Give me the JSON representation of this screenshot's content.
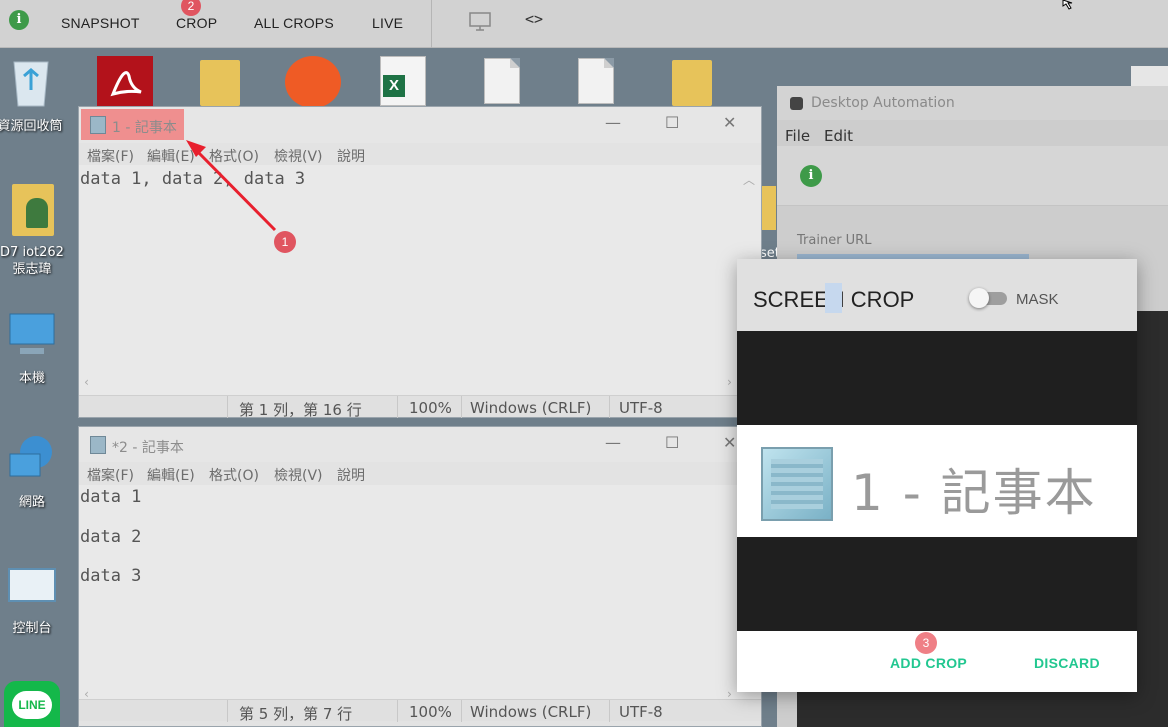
{
  "toolbar": {
    "info": "i",
    "items": [
      "SNAPSHOT",
      "CROP",
      "ALL CROPS",
      "LIVE"
    ],
    "crop_badge": "2",
    "code_icon": "<>"
  },
  "desktop": {
    "recycle_bin": "資源回收筒",
    "user_folder_line1": "D7 iot262",
    "user_folder_line2": "張志瑋",
    "this_pc": "本機",
    "network": "網路",
    "control_panel": "控制台",
    "line_app": "LINE",
    "partial_label": "set"
  },
  "notepad1": {
    "title": "1 - 記事本",
    "menu": [
      "檔案(F)",
      "編輯(E)",
      "格式(O)",
      "檢視(V)",
      "說明"
    ],
    "content": "data 1, data 2, data 3",
    "status": [
      "第 1 列，第 16 行",
      "100%",
      "Windows (CRLF)",
      "UTF-8"
    ]
  },
  "notepad2": {
    "title": "*2 - 記事本",
    "menu": [
      "檔案(F)",
      "編輯(E)",
      "格式(O)",
      "檢視(V)",
      "說明"
    ],
    "lines": [
      "data 1",
      "data 2",
      "data 3"
    ],
    "status": [
      "第 5 列，第 7 行",
      "100%",
      "Windows (CRLF)",
      "UTF-8"
    ]
  },
  "automation_window": {
    "title": "Desktop Automation",
    "menu": [
      "File",
      "Edit"
    ],
    "info": "i",
    "field_label": "Trainer URL"
  },
  "crop_dialog": {
    "title": "SCREEN CROP",
    "mask_label": "MASK",
    "preview_text": "1 - 記事本",
    "add_crop": "ADD CROP",
    "discard": "DISCARD",
    "add_badge": "3"
  },
  "annotations": {
    "arrow_badge": "1"
  },
  "colors": {
    "accent_green": "#22c790",
    "badge_red": "#e05560",
    "highlight_red": "#ef8f8f"
  }
}
